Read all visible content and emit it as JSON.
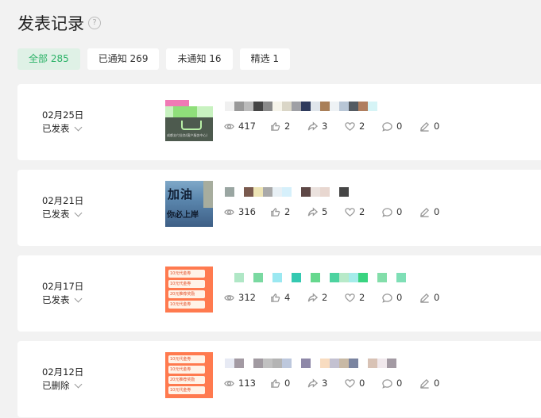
{
  "page": {
    "title": "发表记录",
    "help_icon": "?"
  },
  "tabs": [
    {
      "label": "全部 285",
      "active": true
    },
    {
      "label": "已通知 269",
      "active": false
    },
    {
      "label": "未通知 16",
      "active": false
    },
    {
      "label": "精选 1",
      "active": false
    }
  ],
  "posts": [
    {
      "date": "02月25日",
      "status": "已发表",
      "views": "417",
      "likes": "2",
      "shares": "3",
      "favorites": "2",
      "comments": "0",
      "edits": "0",
      "thumb_caption": "成都支付业务(客户服务中心)",
      "title_colors": [
        "#f0f0f0",
        "#999999",
        "#bbbbbb",
        "#444444",
        "#8a8a8a",
        "#f6f4ea",
        "#dad6c7",
        "#9fa0a5",
        "#2e3a5c",
        "#dfe5eb",
        "#a97f58",
        "#eef2f5",
        "#b8c6d6",
        "#545b62",
        "#b07e5e",
        "#d6f4f6"
      ]
    },
    {
      "date": "02月21日",
      "status": "已发表",
      "views": "316",
      "likes": "2",
      "shares": "5",
      "favorites": "2",
      "comments": "0",
      "edits": "0",
      "thumb_text_1": "加油",
      "thumb_text_2": "你必上岸",
      "title_colors": [
        "#9aa6a2",
        "#ffffff",
        "#7a5a4e",
        "#ede4b5",
        "#a9a9a9",
        "#e8f0f5",
        "#d6f0fb",
        "#ffffff",
        "#5e4846",
        "#ebe2de",
        "#e8d7d0",
        "#ffffff",
        "#464646"
      ]
    },
    {
      "date": "02月17日",
      "status": "已发表",
      "views": "312",
      "likes": "4",
      "shares": "2",
      "favorites": "2",
      "comments": "0",
      "edits": "0",
      "thumb_rows": [
        "10元代金券",
        "10元代金券",
        "20元推荐奖励",
        "10元代金券"
      ],
      "title_colors": [
        "#ffffff",
        "#b0e7c6",
        "#ffffff",
        "#7ad9a1",
        "#ffffff",
        "#9be8f1",
        "#ffffff",
        "#34c9b1",
        "#ffffff",
        "#66d88e",
        "#ffffff",
        "#4dd3a0",
        "#b8eac9",
        "#a5ecea",
        "#39d480",
        "#ffffff",
        "#83deaa",
        "#ffffff",
        "#7fdfb6"
      ]
    },
    {
      "date": "02月12日",
      "status": "已删除",
      "views": "113",
      "likes": "0",
      "shares": "3",
      "favorites": "0",
      "comments": "0",
      "edits": "0",
      "thumb_rows": [
        "10元代金券",
        "10元代金券",
        "20元推荐奖励",
        "10元代金券"
      ],
      "title_colors": [
        "#e7eaf4",
        "#a39aa3",
        "#ffffff",
        "#a19aa1",
        "#c1c1c1",
        "#b4b4b4",
        "#bdc8dd",
        "#ffffff",
        "#8e88a8",
        "#ffffff",
        "#f8dcc0",
        "#c3c1d1",
        "#c8b9a5",
        "#7a84a0",
        "#ffffff",
        "#d8c2b5",
        "#f0e8ec",
        "#a39aa3"
      ]
    }
  ],
  "icons": {
    "views": "eye-icon",
    "likes": "thumb-up-icon",
    "shares": "share-icon",
    "favorites": "heart-icon",
    "comments": "comment-icon",
    "edits": "pen-icon"
  },
  "colors": {
    "accent": "#2bb267",
    "accent_bg": "#dff1e6",
    "page_bg": "#f2f2f2"
  }
}
